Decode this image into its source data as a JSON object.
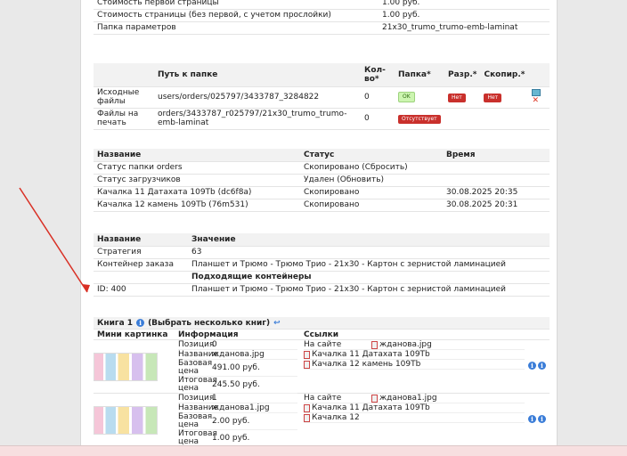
{
  "colors": {
    "ok": "#ccf5b0",
    "bad": "#c9302c",
    "header_bg": "#f2f2f2",
    "arrow": "#d93025"
  },
  "params": [
    [
      "Стоимость первой страницы",
      "1.00 руб."
    ],
    [
      "Стоимость страницы (без первой, с учетом прослойки)",
      "1.00 руб."
    ],
    [
      "Папка параметров",
      "21x30_trumo_trumo-emb-laminat"
    ]
  ],
  "folders": {
    "headers": [
      "Путь к папке",
      "Кол-во*",
      "Папка*",
      "Разр.*",
      "Скопир.*"
    ],
    "rows": [
      {
        "name": "Исходные файлы",
        "path": "users/orders/025797/3433787_3284822",
        "count": "0",
        "folder": "OK",
        "perm": "Нет",
        "copied": "Нет"
      },
      {
        "name": "Файлы на печать",
        "path": "orders/3433787_r025797/21x30_trumo_trumo-emb-laminat",
        "count": "0",
        "folder": "Отсутствует"
      }
    ]
  },
  "status": {
    "headers": [
      "Название",
      "Статус",
      "Время"
    ],
    "rows": [
      [
        "Статус папки orders",
        "Скопировано (Сбросить)",
        ""
      ],
      [
        "Статус загрузчиков",
        "Удален (Обновить)",
        ""
      ],
      [
        "Качалка 11 Датахата 109Tb (dc6f8a)",
        "Скопировано",
        "30.08.2025 20:35"
      ],
      [
        "Качалка 12 камень 109Tb (76m531)",
        "Скопировано",
        "30.08.2025 20:31"
      ]
    ]
  },
  "strategy": {
    "headers": [
      "Название",
      "Значение"
    ],
    "rows": [
      [
        "Стратегия",
        "63"
      ],
      [
        "Контейнер заказа",
        "Планшет и Трюмо - Трюмо Трио - 21x30 - Картон с зернистой ламинацией"
      ]
    ],
    "sub_header": "Подходящие контейнеры",
    "container": [
      "ID: 400",
      "Планшет и Трюмо - Трюмо Трио - 21x30 - Картон с зернистой ламинацией"
    ]
  },
  "book": {
    "title": "Книга 1",
    "select_link": "(Выбрать несколько книг)",
    "headers": [
      "Мини картинка",
      "Информация",
      "Ссылки"
    ],
    "rows": [
      {
        "info": [
          [
            "Позиция",
            "0"
          ],
          [
            "Название",
            "ждановa.jpg"
          ],
          [
            "Базовая цена",
            "491.00 руб."
          ],
          [
            "Итоговая цена",
            "245.50 руб."
          ]
        ],
        "links": [
          [
            "На сайте",
            "ждановa.jpg"
          ],
          [
            "Качалка 11 Датахата 109Tb",
            ""
          ],
          [
            "Качалка 12 камень 109Tb",
            ""
          ]
        ]
      },
      {
        "info": [
          [
            "Позиция",
            "1"
          ],
          [
            "Название",
            "ждановa1.jpg"
          ],
          [
            "Базовая цена",
            "2.00 руб."
          ],
          [
            "Итоговая цена",
            "1.00 руб."
          ]
        ],
        "links": [
          [
            "На сайте",
            "ждановa1.jpg"
          ],
          [
            "Качалка 11 Датахата 109Tb",
            ""
          ],
          [
            "Качалка 12",
            ""
          ]
        ]
      }
    ]
  }
}
